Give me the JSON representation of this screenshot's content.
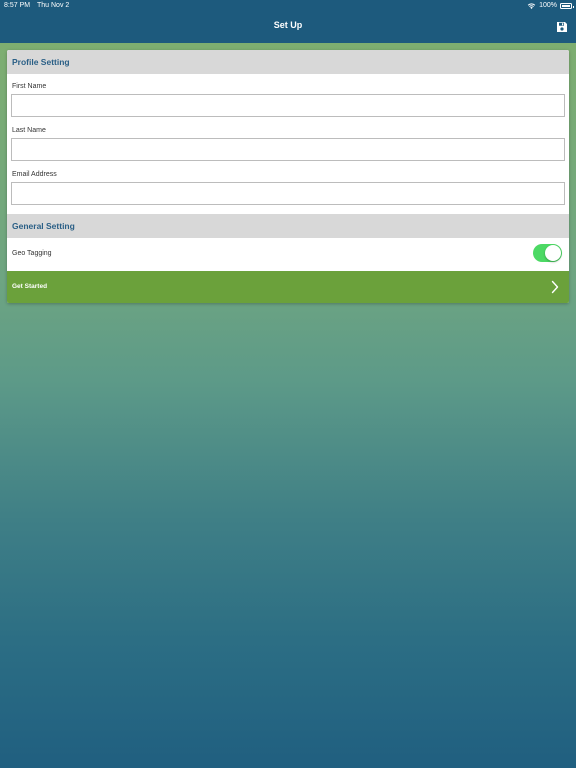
{
  "status_bar": {
    "time": "8:57 PM",
    "date": "Thu Nov 2",
    "battery": "100%"
  },
  "nav": {
    "title": "Set Up",
    "save_icon": "save-icon"
  },
  "profile_section": {
    "title": "Profile Setting",
    "fields": [
      {
        "label": "First Name",
        "value": "",
        "placeholder": ""
      },
      {
        "label": "Last Name",
        "value": "",
        "placeholder": ""
      },
      {
        "label": "Email Address",
        "value": "",
        "placeholder": ""
      }
    ]
  },
  "general_section": {
    "title": "General Setting",
    "geo_tagging": {
      "label": "Geo Tagging",
      "enabled": true
    }
  },
  "get_started": {
    "label": "Get Started",
    "icon": "chevron-right-icon"
  },
  "colors": {
    "nav_bar": "#1d5a7d",
    "section_title": "#2a5f86",
    "section_bg": "#d8d8d8",
    "toggle_on": "#4cd964",
    "get_started_bg": "#6ba13b"
  }
}
